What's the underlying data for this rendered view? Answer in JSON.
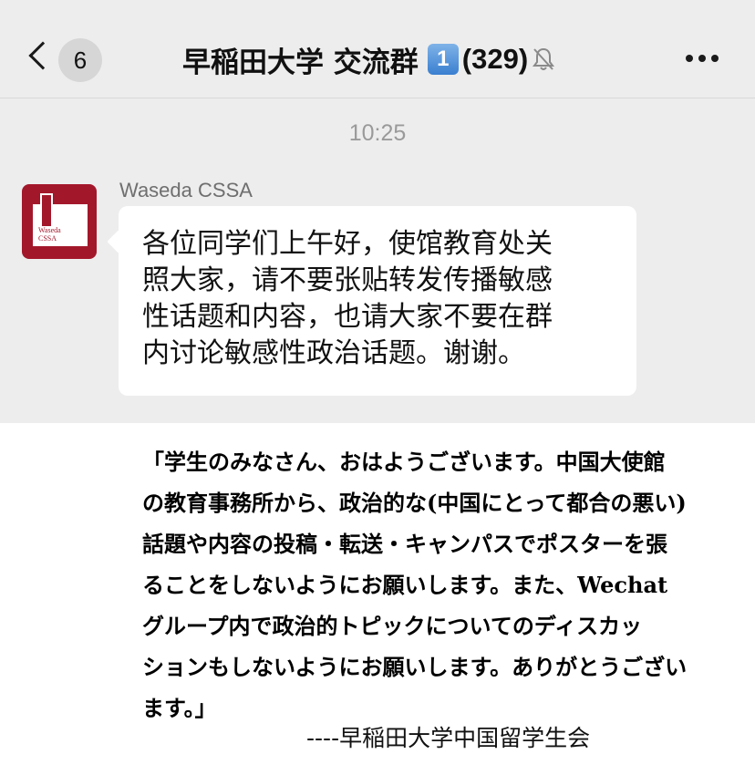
{
  "header": {
    "unread_count": "6",
    "group_name": "早稲田大学 交流群",
    "badge": "1",
    "member_count": "(329)"
  },
  "chat": {
    "timestamp": "10:25",
    "message": {
      "sender": "Waseda CSSA",
      "avatar_text": [
        "Waseda",
        "CSSA"
      ],
      "lines": [
        "各位同学们上午好，使馆教育处关",
        "照大家，请不要张贴转发传播敏感",
        "性话题和内容，也请大家不要在群",
        "内讨论敏感性政治话题。谢谢。"
      ]
    }
  },
  "translation": {
    "lines": [
      "「学生のみなさん、おはようございます。中国大使館",
      "の教育事務所から、政治的な(中国にとって都合の悪い)",
      "話題や内容の投稿・転送・キャンパスでポスターを張",
      "ることをしないようにお願いします。また、Wechat",
      "グループ内で政治的トピックについてのディスカッ",
      "ションもしないようにお願いします。ありがとうござい",
      "ます。」"
    ],
    "signature": "----早稲田大学中国留学生会"
  },
  "icons": {
    "back": "chevron-left-icon",
    "mute": "bell-off-icon",
    "more": "more-dots-icon"
  },
  "colors": {
    "chat_background": "#ededed",
    "bubble": "#ffffff",
    "avatar": "#a3172b",
    "timestamp": "#9a9a9a"
  }
}
